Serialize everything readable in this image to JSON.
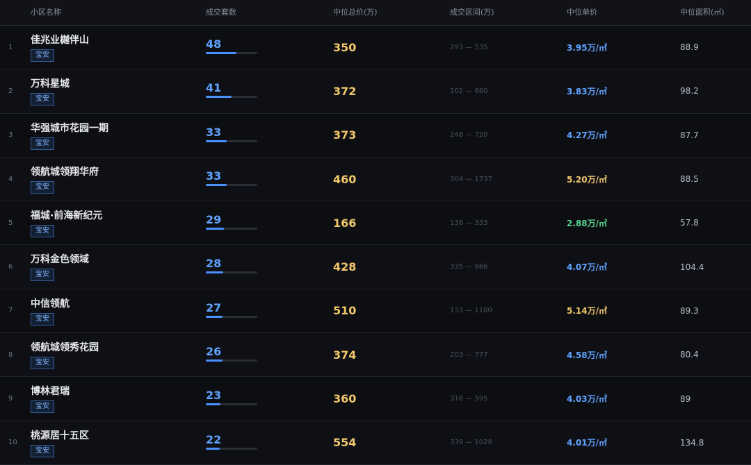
{
  "header": {
    "name": "小区名称",
    "count": "成交套数",
    "median_total": "中位总价(万)",
    "range": "成交区间(万)",
    "median_unit": "中位单价",
    "median_area": "中位面积(㎡)"
  },
  "colors": {
    "unit_blue": "#5fa3ff",
    "unit_gold": "#f1c76c",
    "unit_green": "#56d38a"
  },
  "rows": [
    {
      "rank": "1",
      "name": "佳兆业樾伴山",
      "district": "宝安",
      "count": "48",
      "bar_fill_fraction": 0.6,
      "price": "350",
      "range": "293 — 535",
      "unit": "3.95万/㎡",
      "unit_color": "#5fa3ff",
      "area": "88.9"
    },
    {
      "rank": "2",
      "name": "万科星城",
      "district": "宝安",
      "count": "41",
      "bar_fill_fraction": 0.5,
      "price": "372",
      "range": "102 — 660",
      "unit": "3.83万/㎡",
      "unit_color": "#5fa3ff",
      "area": "98.2"
    },
    {
      "rank": "3",
      "name": "华强城市花园一期",
      "district": "宝安",
      "count": "33",
      "bar_fill_fraction": 0.4,
      "price": "373",
      "range": "248 — 720",
      "unit": "4.27万/㎡",
      "unit_color": "#5fa3ff",
      "area": "87.7"
    },
    {
      "rank": "4",
      "name": "领航城领翔华府",
      "district": "宝安",
      "count": "33",
      "bar_fill_fraction": 0.4,
      "price": "460",
      "range": "304 — 1737",
      "unit": "5.20万/㎡",
      "unit_color": "#f1c76c",
      "area": "88.5"
    },
    {
      "rank": "5",
      "name": "福城·前海新纪元",
      "district": "宝安",
      "count": "29",
      "bar_fill_fraction": 0.35,
      "price": "166",
      "range": "136 — 333",
      "unit": "2.88万/㎡",
      "unit_color": "#56d38a",
      "area": "57.8"
    },
    {
      "rank": "6",
      "name": "万科金色领域",
      "district": "宝安",
      "count": "28",
      "bar_fill_fraction": 0.34,
      "price": "428",
      "range": "335 — 866",
      "unit": "4.07万/㎡",
      "unit_color": "#5fa3ff",
      "area": "104.4"
    },
    {
      "rank": "7",
      "name": "中信领航",
      "district": "宝安",
      "count": "27",
      "bar_fill_fraction": 0.33,
      "price": "510",
      "range": "133 — 1100",
      "unit": "5.14万/㎡",
      "unit_color": "#f1c76c",
      "area": "89.3"
    },
    {
      "rank": "8",
      "name": "领航城领秀花园",
      "district": "宝安",
      "count": "26",
      "bar_fill_fraction": 0.32,
      "price": "374",
      "range": "203 — 777",
      "unit": "4.58万/㎡",
      "unit_color": "#5fa3ff",
      "area": "80.4"
    },
    {
      "rank": "9",
      "name": "博林君瑞",
      "district": "宝安",
      "count": "23",
      "bar_fill_fraction": 0.28,
      "price": "360",
      "range": "316 — 595",
      "unit": "4.03万/㎡",
      "unit_color": "#5fa3ff",
      "area": "89"
    },
    {
      "rank": "10",
      "name": "桃源居十五区",
      "district": "宝安",
      "count": "22",
      "bar_fill_fraction": 0.27,
      "price": "554",
      "range": "339 — 1028",
      "unit": "4.01万/㎡",
      "unit_color": "#5fa3ff",
      "area": "134.8"
    }
  ]
}
